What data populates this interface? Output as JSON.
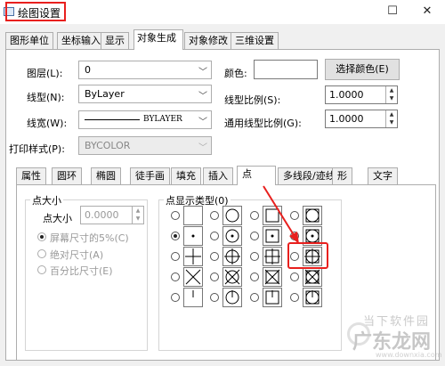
{
  "window": {
    "title": "绘图设置",
    "close_glyph": "✕",
    "maximize_glyph": "☐"
  },
  "top_tabs": [
    "图形单位",
    "坐标输入",
    "显示",
    "对象生成",
    "对象修改",
    "三维设置"
  ],
  "fields": {
    "layer_label": "图层(L):",
    "layer_value": "0",
    "linetype_label": "线型(N):",
    "linetype_value": "ByLayer",
    "lineweight_label": "线宽(W):",
    "lineweight_value": "BYLAYER",
    "plotstyle_label": "打印样式(P):",
    "plotstyle_value": "BYCOLOR",
    "color_label": "颜色:",
    "choose_color": "选择颜色(E)",
    "lt_scale_label": "线型比例(S):",
    "lt_scale_value": "1.0000",
    "global_lt_label": "通用线型比例(G):",
    "global_lt_value": "1.0000"
  },
  "bottom_tabs": [
    "属性",
    "圆环",
    "椭圆",
    "徒手画",
    "填充",
    "插入",
    "点",
    "多线段/迹线",
    "形",
    "文字"
  ],
  "point_size": {
    "group_label": "点大小",
    "size_label": "点大小",
    "size_value": "0.0000",
    "opt1": "屏幕尺寸的5%(C)",
    "opt2": "绝对尺寸(A)",
    "opt3": "百分比尺寸(E)"
  },
  "point_style": {
    "group_label": "点显示类型(0)"
  },
  "watermark": {
    "brand": "当下软件园",
    "sub": "广东龙网",
    "url": "www.downxia.com"
  },
  "colors": {
    "highlight": "#e8201e"
  }
}
